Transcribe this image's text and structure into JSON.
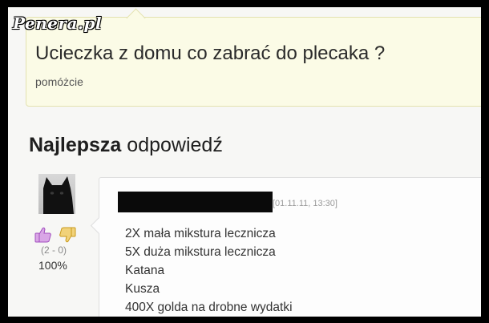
{
  "watermark": {
    "text": "Penera.pl"
  },
  "question": {
    "title": "Ucieczka z domu co zabrać do plecaka ?",
    "subtitle": "pomóżcie"
  },
  "best_answer": {
    "heading_bold": "Najlepsza",
    "heading_rest": " odpowiedź",
    "author": {
      "avatar_icon": "black-cat-avatar",
      "votes_label": "(2 - 0)",
      "rating": "100%"
    },
    "date": "[01.11.11, 13:30]",
    "lines": [
      "2X mała mikstura lecznicza",
      "5X duża mikstura lecznicza",
      "Katana",
      "Kusza",
      "400X golda na drobne wydatki"
    ]
  },
  "colors": {
    "question_bg": "#fbfbe6",
    "question_border": "#e3e2b0",
    "answer_bg": "#fdfdfd",
    "thumb_up": "#b05bc9",
    "thumb_down": "#e0b528",
    "outer_frame": "#000000"
  }
}
